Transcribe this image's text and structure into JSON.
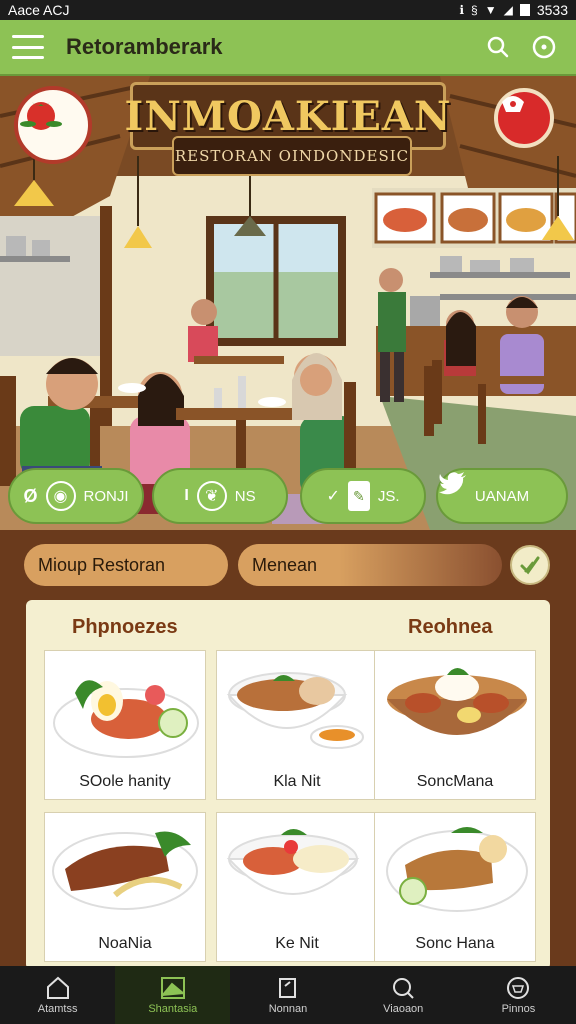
{
  "status_bar": {
    "carrier": "Aace ACJ",
    "time": "3533"
  },
  "app_bar": {
    "title": "Retoramberark"
  },
  "hero": {
    "banner_title": "INMOAKIEAN",
    "banner_subtitle": "RESTORAN OINDONDESIC",
    "chips": [
      {
        "label": "RONJI",
        "icons": [
          "o",
          "camera-icon"
        ]
      },
      {
        "label": "NS",
        "icons": [
          "I",
          "leaf-icon"
        ]
      },
      {
        "label": "JS.",
        "icons": [
          "check-icon",
          "pin-icon"
        ]
      },
      {
        "label": "UANAM",
        "icons": [
          "bird-icon"
        ]
      }
    ]
  },
  "filters": {
    "pill_one": "Mioup Restoran",
    "pill_two": "Menean"
  },
  "menu": {
    "left_heading": "Phpnoezes",
    "right_heading": "Reohnea",
    "dishes": [
      {
        "name": "SOole hanity"
      },
      {
        "name": "Kla Nit"
      },
      {
        "name": "SoncMana"
      },
      {
        "name": "NoaNia"
      },
      {
        "name": "Ke Nit"
      },
      {
        "name": "Sonc Hana"
      }
    ]
  },
  "bottom_nav": [
    {
      "label": "Atamtss",
      "icon": "home-icon"
    },
    {
      "label": "Shantasia",
      "icon": "image-icon"
    },
    {
      "label": "Nonnan",
      "icon": "tag-icon"
    },
    {
      "label": "Viaoaon",
      "icon": "search-icon"
    },
    {
      "label": "Pinnos",
      "icon": "basket-icon"
    }
  ],
  "colors": {
    "accent_green": "#8dc255",
    "wood_brown": "#6a3a1c",
    "card_cream": "#f4efd0",
    "banner_gold": "#f0c860"
  }
}
